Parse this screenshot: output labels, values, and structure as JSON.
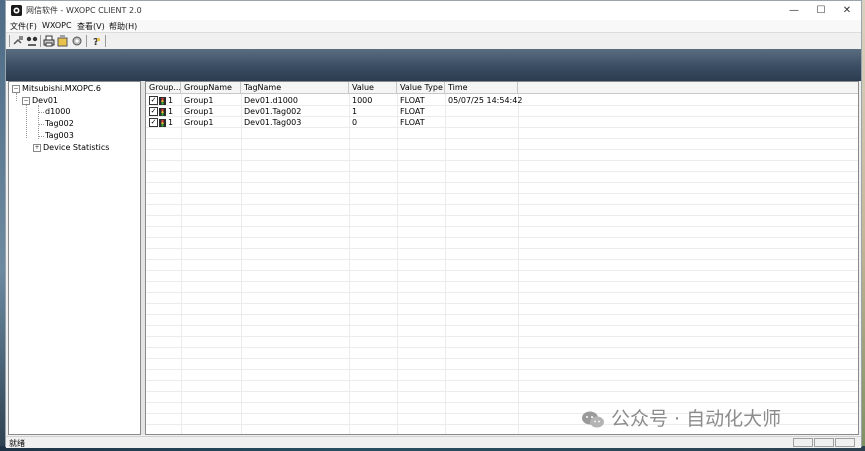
{
  "window": {
    "title": "网信软件 - WXOPC CLIENT 2.0",
    "controls": {
      "minimize": "—",
      "maximize": "☐",
      "close": "✕"
    }
  },
  "menu": [
    {
      "label": "文件(F)"
    },
    {
      "label": "WXOPC"
    },
    {
      "label": "查看(V)"
    },
    {
      "label": "帮助(H)"
    }
  ],
  "toolbar": {
    "buttons": [
      {
        "icon": "connect-icon"
      },
      {
        "icon": "disconnect-icon"
      },
      {
        "icon": "print-icon"
      },
      {
        "icon": "add-group-icon"
      },
      {
        "icon": "settings-icon"
      },
      {
        "icon": "help-icon"
      }
    ]
  },
  "tree": {
    "server": "Mitsubishi.MXOPC.6",
    "device": "Dev01",
    "tags": [
      "d1000",
      "Tag002",
      "Tag003"
    ],
    "statistics": "Device Statistics",
    "expanded_symbol": "−",
    "collapsed_symbol": "+"
  },
  "list": {
    "columns": [
      "Group...",
      "GroupName",
      "TagName",
      "Value",
      "Value Type",
      "Time"
    ],
    "rows": [
      {
        "check": "✓",
        "group_id": "1",
        "group_name": "Group1",
        "tag_name": "Dev01.d1000",
        "value": "1000",
        "value_type": "FLOAT",
        "time": "05/07/25 14:54:42"
      },
      {
        "check": "✓",
        "group_id": "1",
        "group_name": "Group1",
        "tag_name": "Dev01.Tag002",
        "value": "1",
        "value_type": "FLOAT",
        "time": ""
      },
      {
        "check": "✓",
        "group_id": "1",
        "group_name": "Group1",
        "tag_name": "Dev01.Tag003",
        "value": "0",
        "value_type": "FLOAT",
        "time": ""
      }
    ]
  },
  "status": {
    "text": "就绪"
  },
  "watermark": {
    "text": "公众号 · 自动化大师"
  },
  "colors": {
    "banner": "#3a4d62",
    "title_bg": "#ffffff"
  }
}
